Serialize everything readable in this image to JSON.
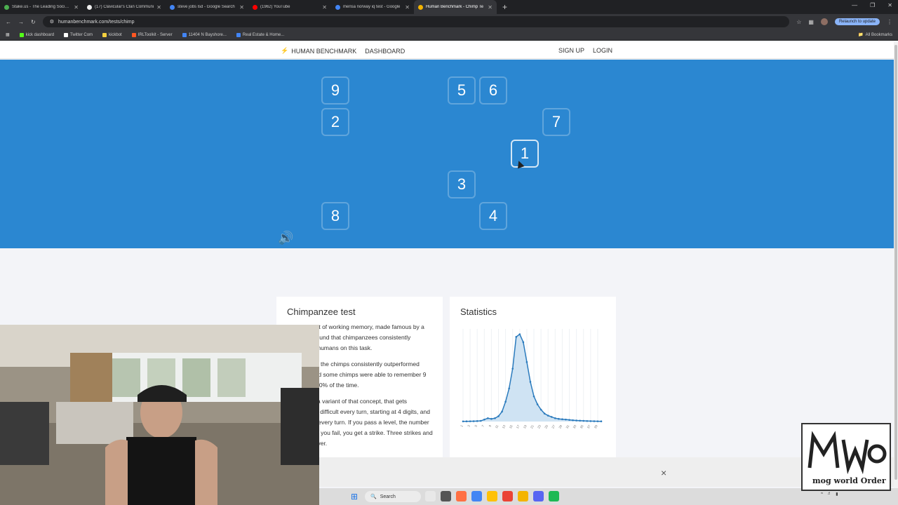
{
  "browser": {
    "tabs": [
      {
        "label": "Stake.us - The Leading Social C",
        "color": "#4caf50",
        "active": false
      },
      {
        "label": "(17) Clavicular's Clan Communi",
        "color": "#eeeeee",
        "active": false
      },
      {
        "label": "steve jobs lsd - Google Search",
        "color": "#4285f4",
        "active": false
      },
      {
        "label": "(1962) YouTube",
        "color": "#ff0000",
        "active": false
      },
      {
        "label": "mensa norway iq test - Google",
        "color": "#4285f4",
        "active": false
      },
      {
        "label": "Human Benchmark - Chimp Te",
        "color": "#f4b400",
        "active": true
      }
    ],
    "url": "humanbenchmark.com/tests/chimp",
    "relaunch_label": "Relaunch to update",
    "bookmarks": [
      {
        "label": "kick dashboard",
        "color": "#53fc18"
      },
      {
        "label": "Twitter Com",
        "color": "#ffffff"
      },
      {
        "label": "kickbot",
        "color": "#f4d03f"
      },
      {
        "label": "IRLToolkit - Server",
        "color": "#ff5722"
      },
      {
        "label": "11404 N Bayshore...",
        "color": "#4285f4"
      },
      {
        "label": "Real Estate & Home...",
        "color": "#4285f4"
      }
    ],
    "all_bookmarks_label": "All Bookmarks"
  },
  "site_nav": {
    "brand": "HUMAN BENCHMARK",
    "dashboard": "DASHBOARD",
    "signup": "SIGN UP",
    "login": "LOGIN"
  },
  "grid_cells": [
    {
      "n": "9"
    },
    {
      "n": "5"
    },
    {
      "n": "6"
    },
    {
      "n": "2"
    },
    {
      "n": "7"
    },
    {
      "n": "1"
    },
    {
      "n": "3"
    },
    {
      "n": "8"
    },
    {
      "n": "4"
    }
  ],
  "card_info": {
    "title": "Chimpanzee test",
    "paragraphs": [
      "This is a test of working memory, made famous by a study that found that chimpanzees consistently outperform humans on this task.",
      "In the study, the chimps consistently outperformed humans, and some chimps were able to remember 9 digits over 90% of the time.",
      "This test is a variant of that concept, that gets increasingly difficult every turn, starting at 4 digits, and adding one every turn. If you pass a level, the number increases. If you fail, you get a strike. Three strikes and the test is over."
    ]
  },
  "card_stats": {
    "title": "Statistics"
  },
  "chart_data": {
    "type": "area",
    "title": "",
    "xlabel": "",
    "ylabel": "",
    "x": [
      1,
      2,
      3,
      4,
      5,
      6,
      7,
      8,
      9,
      10,
      11,
      12,
      13,
      14,
      15,
      16,
      17,
      18,
      19,
      20,
      21,
      22,
      23,
      24,
      25,
      26,
      27,
      28,
      29,
      30,
      31,
      32,
      33,
      34,
      35,
      36,
      37,
      38,
      39,
      40
    ],
    "values": [
      0.2,
      0.3,
      0.4,
      0.5,
      0.7,
      1,
      3,
      5,
      4,
      5,
      8,
      15,
      30,
      50,
      80,
      128,
      132,
      120,
      90,
      60,
      38,
      26,
      18,
      12,
      9,
      7,
      5,
      4,
      3.5,
      3,
      2.5,
      2,
      1.6,
      1.3,
      1,
      0.8,
      0.6,
      0.5,
      0.4,
      0.3
    ],
    "ylim": [
      0,
      140
    ],
    "grid": true,
    "color": "#2b7bbd"
  },
  "footer_close": "×",
  "taskbar": {
    "search": "Search",
    "apps": [
      "#e8e8e8",
      "#555555",
      "#ff7043",
      "#4285f4",
      "#ffc107",
      "#ea4335",
      "#f4b400",
      "#5865f2",
      "#1db954"
    ]
  },
  "logo": {
    "text": "mog world Order"
  }
}
